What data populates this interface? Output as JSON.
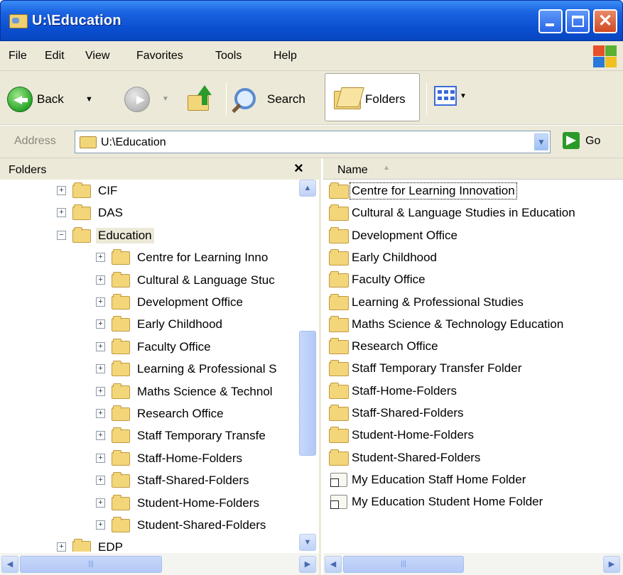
{
  "window": {
    "title": "U:\\Education"
  },
  "menu": [
    "File",
    "Edit",
    "View",
    "Favorites",
    "Tools",
    "Help"
  ],
  "toolbar": {
    "back_label": "Back",
    "search_label": "Search",
    "folders_label": "Folders"
  },
  "address": {
    "label": "Address",
    "value": "U:\\Education",
    "go_label": "Go"
  },
  "folders_pane": {
    "title": "Folders",
    "close": "×",
    "tree": [
      {
        "label": "CIF",
        "level": 0,
        "expander": "+"
      },
      {
        "label": "DAS",
        "level": 0,
        "expander": "+"
      },
      {
        "label": "Education",
        "level": 0,
        "expander": "−",
        "selected": true
      },
      {
        "label": "Centre for Learning Inno",
        "level": 1,
        "expander": "+"
      },
      {
        "label": "Cultural & Language Stuc",
        "level": 1,
        "expander": "+"
      },
      {
        "label": "Development Office",
        "level": 1,
        "expander": "+"
      },
      {
        "label": "Early Childhood",
        "level": 1,
        "expander": "+"
      },
      {
        "label": "Faculty Office",
        "level": 1,
        "expander": "+"
      },
      {
        "label": "Learning & Professional S",
        "level": 1,
        "expander": "+"
      },
      {
        "label": "Maths Science & Technol",
        "level": 1,
        "expander": "+"
      },
      {
        "label": "Research Office",
        "level": 1,
        "expander": "+"
      },
      {
        "label": "Staff Temporary Transfe",
        "level": 1,
        "expander": "+"
      },
      {
        "label": "Staff-Home-Folders",
        "level": 1,
        "expander": "+"
      },
      {
        "label": "Staff-Shared-Folders",
        "level": 1,
        "expander": "+"
      },
      {
        "label": "Student-Home-Folders",
        "level": 1,
        "expander": "+"
      },
      {
        "label": "Student-Shared-Folders",
        "level": 1,
        "expander": "+"
      },
      {
        "label": "EDP",
        "level": 0,
        "expander": "+"
      }
    ]
  },
  "content": {
    "column_name": "Name",
    "items": [
      {
        "label": "Centre for Learning Innovation",
        "type": "folder"
      },
      {
        "label": "Cultural & Language Studies in Education",
        "type": "folder"
      },
      {
        "label": "Development Office",
        "type": "folder"
      },
      {
        "label": "Early Childhood",
        "type": "folder"
      },
      {
        "label": "Faculty Office",
        "type": "folder"
      },
      {
        "label": "Learning & Professional Studies",
        "type": "folder"
      },
      {
        "label": "Maths Science & Technology Education",
        "type": "folder"
      },
      {
        "label": "Research Office",
        "type": "folder"
      },
      {
        "label": "Staff Temporary Transfer Folder",
        "type": "folder"
      },
      {
        "label": "Staff-Home-Folders",
        "type": "folder"
      },
      {
        "label": "Staff-Shared-Folders",
        "type": "folder"
      },
      {
        "label": "Student-Home-Folders",
        "type": "folder"
      },
      {
        "label": "Student-Shared-Folders",
        "type": "folder"
      },
      {
        "label": "My Education Staff Home Folder",
        "type": "shortcut"
      },
      {
        "label": "My Education Student Home Folder",
        "type": "shortcut"
      }
    ]
  }
}
